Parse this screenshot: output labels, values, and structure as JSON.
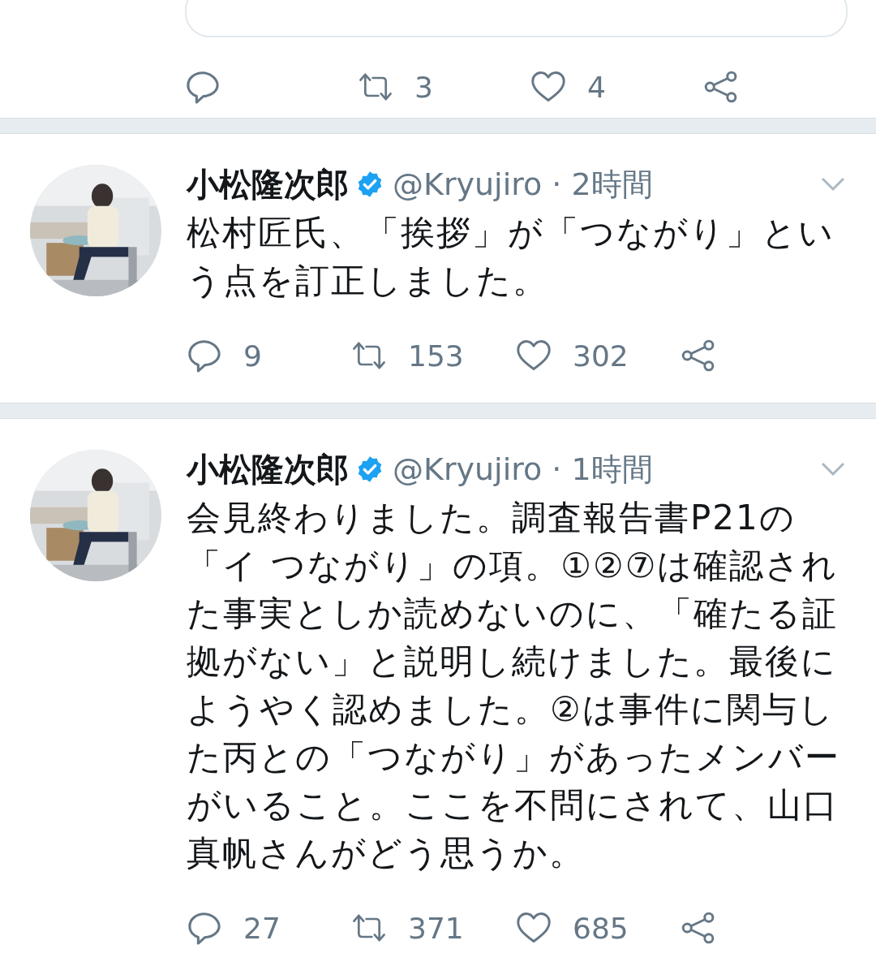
{
  "tweets": [
    {
      "kind": "actions-only",
      "retweets": "3",
      "likes": "4"
    },
    {
      "kind": "tweet",
      "name": "小松隆次郎",
      "verified": true,
      "meta": "@Kryujiro · 2時間",
      "text": "松村匠氏、「挨拶」が「つながり」という点を訂正しました。",
      "replies": "9",
      "retweets": "153",
      "likes": "302"
    },
    {
      "kind": "tweet",
      "name": "小松隆次郎",
      "verified": true,
      "meta": "@Kryujiro · 1時間",
      "text": "会見終わりました。調査報告書P21の「イ つながり」の項。①②⑦は確認された事実としか読めないのに、「確たる証拠がない」と説明し続けました。最後にようやく認めました。②は事件に関与した丙との「つながり」があったメンバーがいること。ここを不問にされて、山口真帆さんがどう思うか。",
      "replies": "27",
      "retweets": "371",
      "likes": "685"
    }
  ]
}
